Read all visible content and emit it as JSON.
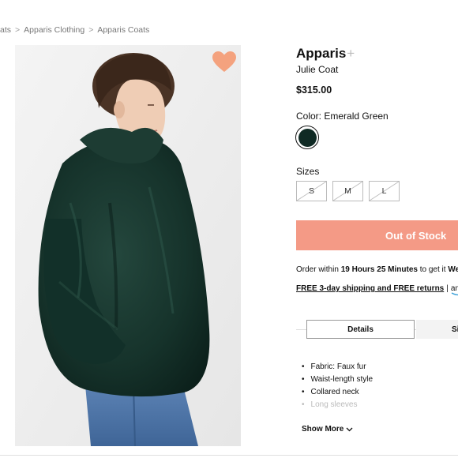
{
  "breadcrumb": {
    "items": [
      "ats",
      "Apparis Clothing",
      "Apparis Coats"
    ],
    "separator": ">"
  },
  "product": {
    "brand": "Apparis",
    "brand_plus": "+",
    "name": "Julie Coat",
    "price": "$315.00",
    "color_label": "Color: Emerald Green",
    "swatch_color": "#0f2a24",
    "sizes_label": "Sizes",
    "sizes": [
      "S",
      "M",
      "L"
    ],
    "favorite_icon": "heart-icon",
    "favorite_color": "#f4a27e"
  },
  "cta": {
    "label": "Out of Stock",
    "color": "#f49a86"
  },
  "delivery": {
    "prefix": "Order within ",
    "time": "19 Hours 25 Minutes",
    "middle": " to get it ",
    "day": "Wed"
  },
  "shipping": {
    "link": "FREE 3-day shipping and FREE returns",
    "separator": "|",
    "partner": "amazo"
  },
  "tabs": {
    "active": "Details",
    "next": "Si"
  },
  "details": {
    "features": [
      "Fabric: Faux fur",
      "Waist-length style",
      "Collared neck",
      "Long sleeves"
    ],
    "show_more": "Show More"
  }
}
